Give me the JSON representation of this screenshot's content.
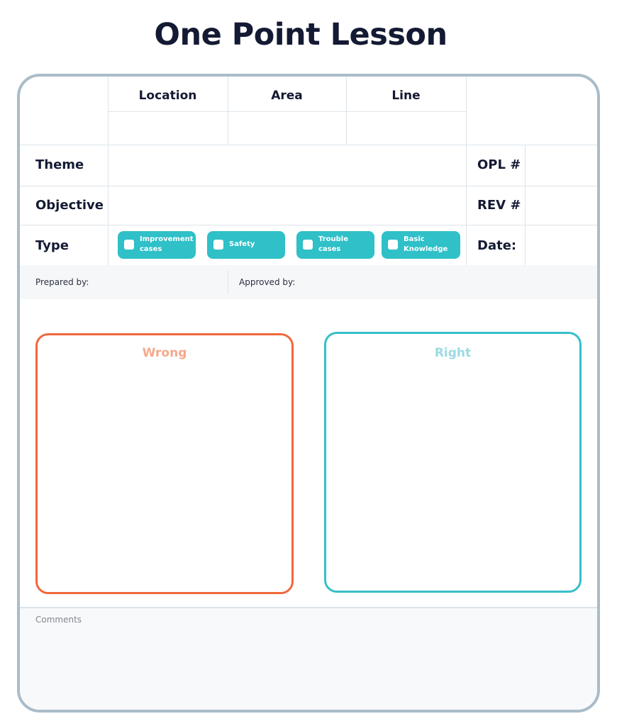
{
  "title": "One Point Lesson",
  "header": {
    "location": "Location",
    "area": "Area",
    "line": "Line"
  },
  "rows": {
    "theme": "Theme",
    "objective": "Objective",
    "type": "Type"
  },
  "side": {
    "opl": "OPL #",
    "rev": "REV #",
    "date": "Date:"
  },
  "type_options": [
    {
      "line1": "Improvement",
      "line2": "cases"
    },
    {
      "line1": "Safety",
      "line2": ""
    },
    {
      "line1": "Trouble",
      "line2": "cases"
    },
    {
      "line1": "Basic",
      "line2": "Knowledge"
    }
  ],
  "prepared_by": "Prepared by:",
  "approved_by": "Approved by:",
  "wrong": {
    "label": "Wrong",
    "border_color": "#f0683b",
    "text_color": "#f6a98c"
  },
  "right": {
    "label": "Right",
    "border_color": "#36bfc9",
    "text_color": "#9adce2"
  },
  "comments": "Comments",
  "colors": {
    "frame": "#a9bcc9",
    "chip": "#2fc0c8",
    "title": "#141a33"
  }
}
